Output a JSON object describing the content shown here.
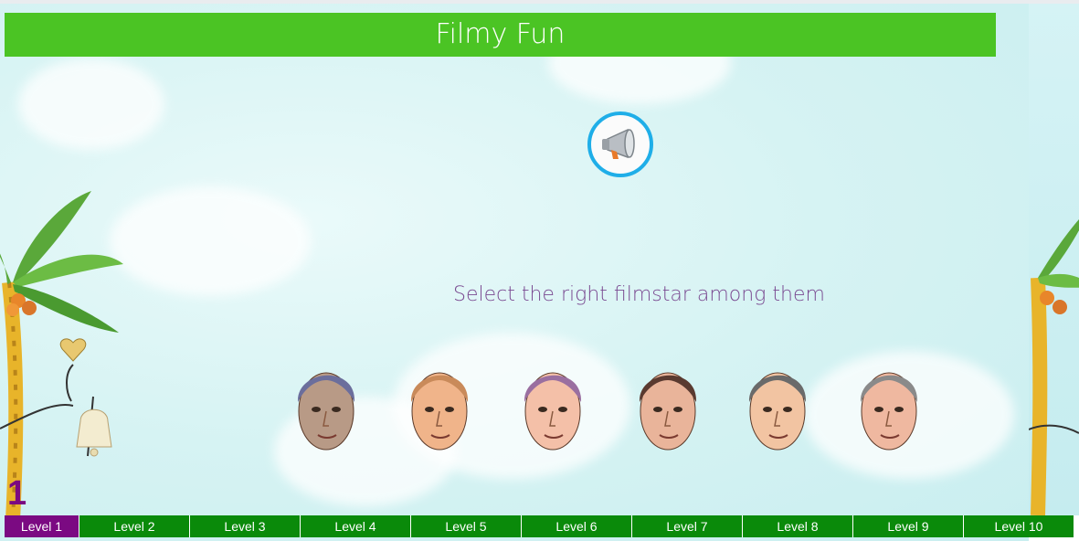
{
  "app": {
    "title": "Filmy Fun"
  },
  "game": {
    "instruction": "Select the right filmstar among them",
    "current_level": "1",
    "faces": [
      {
        "id": "face-1",
        "hair": "#6b6e9c",
        "skin": "#b89a86"
      },
      {
        "id": "face-2",
        "hair": "#c98a5a",
        "skin": "#f0b48a"
      },
      {
        "id": "face-3",
        "hair": "#9a6fa0",
        "skin": "#f4c0a8"
      },
      {
        "id": "face-4",
        "hair": "#5a3a30",
        "skin": "#e9b49a"
      },
      {
        "id": "face-5",
        "hair": "#6a6a6a",
        "skin": "#f2c4a2"
      },
      {
        "id": "face-6",
        "hair": "#8a8a8a",
        "skin": "#efb8a0"
      }
    ]
  },
  "levels": [
    {
      "label": "Level 1",
      "active": true
    },
    {
      "label": "Level 2",
      "active": false
    },
    {
      "label": "Level 3",
      "active": false
    },
    {
      "label": "Level 4",
      "active": false
    },
    {
      "label": "Level 5",
      "active": false
    },
    {
      "label": "Level 6",
      "active": false
    },
    {
      "label": "Level 7",
      "active": false
    },
    {
      "label": "Level 8",
      "active": false
    },
    {
      "label": "Level 9",
      "active": false
    },
    {
      "label": "Level 10",
      "active": false
    }
  ],
  "colors": {
    "title_bar": "#4bc424",
    "level_bar": "#0a8a0a",
    "level_active": "#7b0a82",
    "instruction_text": "#7a4a91",
    "speaker_ring": "#1faee8"
  },
  "icons": {
    "speaker": "megaphone-icon"
  }
}
